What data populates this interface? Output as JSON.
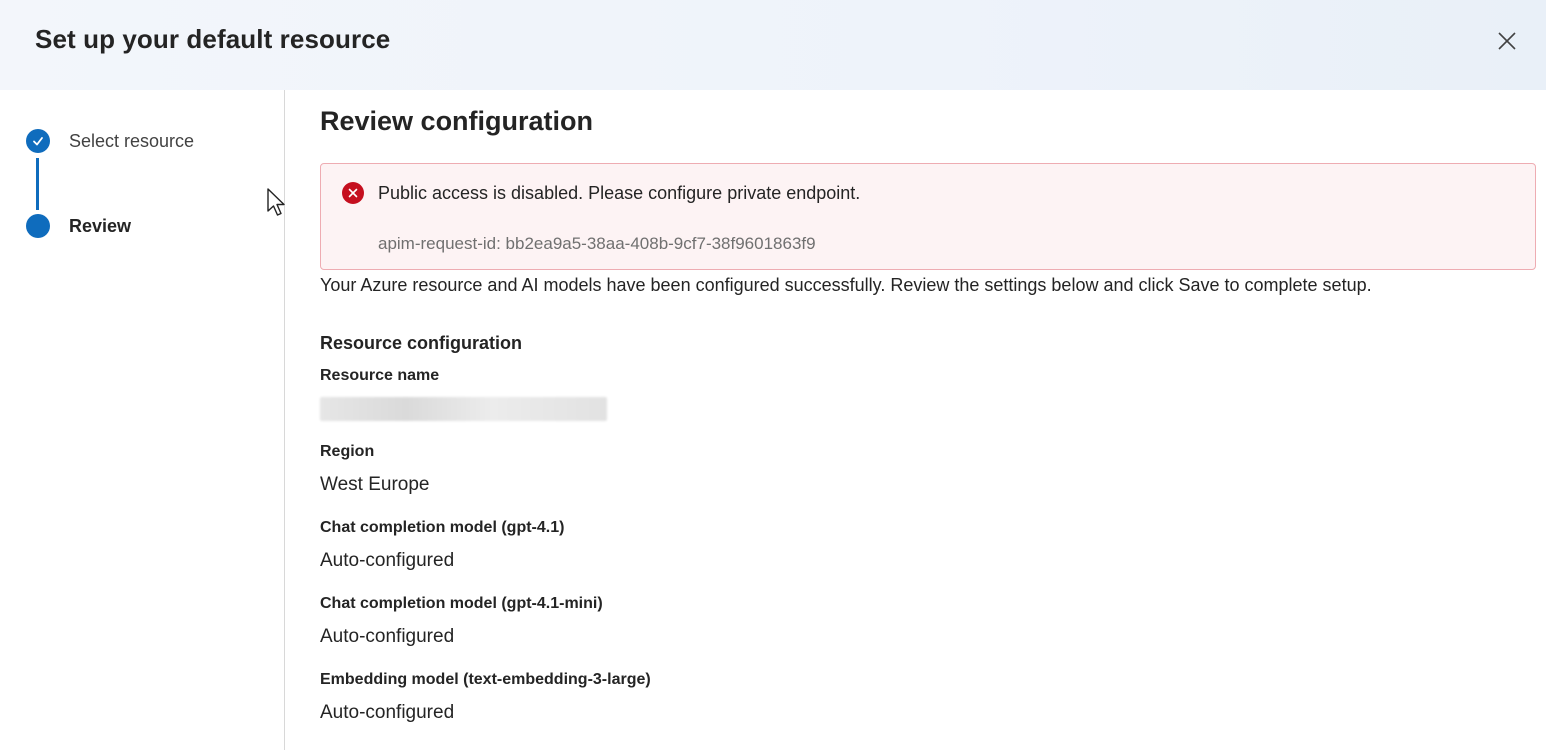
{
  "dialog": {
    "title": "Set up your default resource",
    "close_icon": "close-icon"
  },
  "steps": [
    {
      "label": "Select resource",
      "status": "completed",
      "icon": "checkmark-icon"
    },
    {
      "label": "Review",
      "status": "current"
    }
  ],
  "colors": {
    "accent": "#0f6cbd",
    "error": "#c50f1f",
    "error_bg": "#fdf3f4",
    "error_border": "#eeacb2"
  },
  "review": {
    "title": "Review configuration",
    "error": {
      "icon": "error-circle-icon",
      "message": "Public access is disabled. Please configure private endpoint.",
      "request_id": "apim-request-id: bb2ea9a5-38aa-408b-9cf7-38f9601863f9"
    },
    "description": "Your Azure resource and AI models have been configured successfully. Review the settings below and click Save to complete setup.",
    "section_title": "Resource configuration",
    "fields": [
      {
        "label": "Resource name",
        "value": ""
      },
      {
        "label": "Region",
        "value": "West Europe"
      },
      {
        "label": "Chat completion model (gpt-4.1)",
        "value": "Auto-configured"
      },
      {
        "label": "Chat completion model (gpt-4.1-mini)",
        "value": "Auto-configured"
      },
      {
        "label": "Embedding model (text-embedding-3-large)",
        "value": "Auto-configured"
      }
    ]
  }
}
